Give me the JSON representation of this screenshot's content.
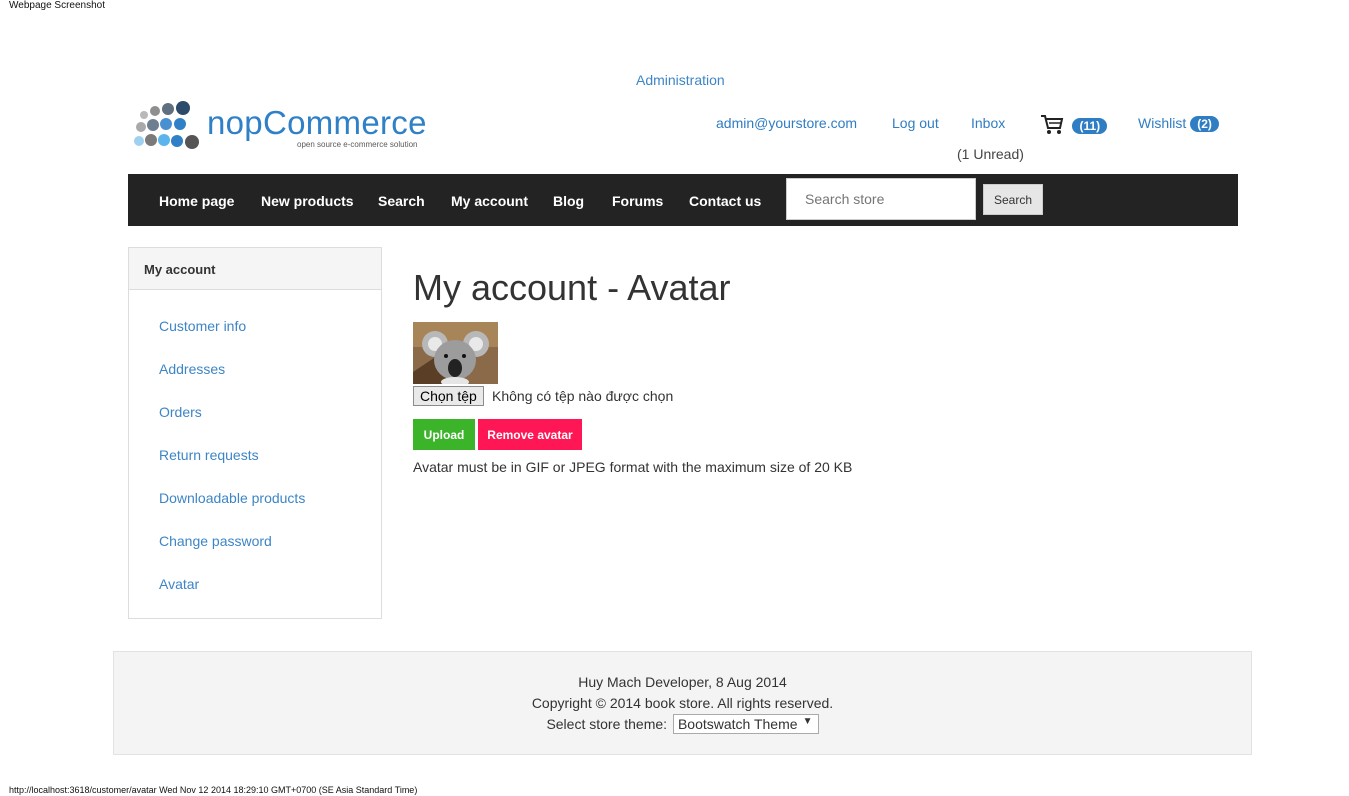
{
  "print": {
    "header": "Webpage Screenshot",
    "footer": "http://localhost:3618/customer/avatar Wed Nov 12 2014 18:29:10 GMT+0700 (SE Asia Standard Time)"
  },
  "admin_link": "Administration",
  "logo": {
    "name": "nopCommerce",
    "tagline": "open source e-commerce solution"
  },
  "header": {
    "email": "admin@yourstore.com",
    "logout": "Log out",
    "inbox": "Inbox",
    "unread": "(1 Unread)",
    "cart_count": "(11)",
    "wishlist": "Wishlist",
    "wishlist_count": "(2)"
  },
  "nav": {
    "items": [
      "Home page",
      "New products",
      "Search",
      "My account",
      "Blog",
      "Forums",
      "Contact us"
    ],
    "search_placeholder": "Search store",
    "search_button": "Search"
  },
  "sidebar": {
    "title": "My account",
    "items": [
      "Customer info",
      "Addresses",
      "Orders",
      "Return requests",
      "Downloadable products",
      "Change password",
      "Avatar"
    ]
  },
  "main": {
    "title": "My account - Avatar",
    "file_button": "Chọn tệp",
    "file_status": "Không có tệp nào được chọn",
    "upload": "Upload",
    "remove": "Remove avatar",
    "note": "Avatar must be in GIF or JPEG format with the maximum size of 20 KB"
  },
  "footer": {
    "line1": "Huy Mach Developer, 8 Aug 2014",
    "line2": "Copyright © 2014 book store. All rights reserved.",
    "theme_label": "Select store theme:",
    "theme_value": "Bootswatch Theme"
  },
  "colors": {
    "link": "#3d85c6",
    "nav_bg": "#232323",
    "upload": "#3bb42a",
    "remove": "#ff1654",
    "badge": "#2f7dc3"
  }
}
